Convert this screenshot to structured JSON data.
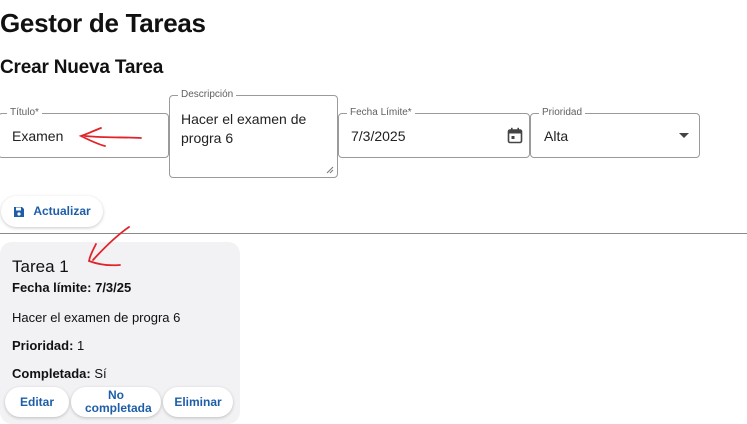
{
  "app_title": "Gestor de Tareas",
  "form": {
    "section_title": "Crear Nueva Tarea",
    "title_field": {
      "label": "Título*",
      "value": "Examen"
    },
    "description_field": {
      "label": "Descripción",
      "value": "Hacer el examen de progra 6"
    },
    "date_field": {
      "label": "Fecha Límite*",
      "value": "7/3/2025",
      "icon": "calendar-icon"
    },
    "priority_field": {
      "label": "Prioridad",
      "value": "Alta",
      "icon": "chevron-down-icon"
    },
    "update_button": {
      "label": "Actualizar",
      "icon": "save-icon"
    }
  },
  "task_card": {
    "title": "Tarea 1",
    "due_label": "Fecha límite:",
    "due_value": "7/3/25",
    "description": "Hacer el examen de progra 6",
    "priority_label": "Prioridad:",
    "priority_value": "1",
    "completed_label": "Completada:",
    "completed_value": "Sí",
    "actions": {
      "edit": "Editar",
      "not_completed": "No completada",
      "delete": "Eliminar"
    }
  },
  "colors": {
    "accent": "#1e5ea8",
    "annotation": "#e0242a",
    "card_bg": "#f2f2f5"
  }
}
